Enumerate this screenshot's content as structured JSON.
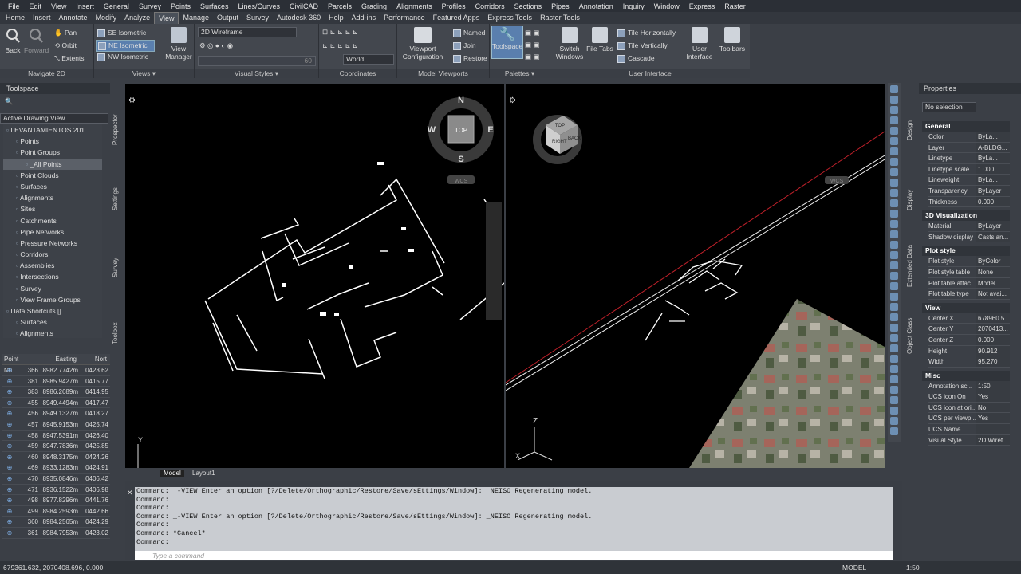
{
  "menu": [
    "File",
    "Edit",
    "View",
    "Insert",
    "General",
    "Survey",
    "Points",
    "Surfaces",
    "Lines/Curves",
    "CivilCAD",
    "Parcels",
    "Grading",
    "Alignments",
    "Profiles",
    "Corridors",
    "Sections",
    "Pipes",
    "Annotation",
    "Inquiry",
    "Window",
    "Express",
    "Raster"
  ],
  "tabs": [
    "Home",
    "Insert",
    "Annotate",
    "Modify",
    "Analyze",
    "View",
    "Manage",
    "Output",
    "Survey",
    "Autodesk 360",
    "Help",
    "Add-ins",
    "Performance",
    "Featured Apps",
    "Express Tools",
    "Raster Tools"
  ],
  "active_tab": "View",
  "ribbon": {
    "navigate": {
      "title": "Navigate 2D",
      "back": "Back",
      "forward": "Forward",
      "pan": "Pan",
      "orbit": "Orbit",
      "extents": "Extents"
    },
    "views": {
      "title": "Views",
      "items": [
        "SE Isometric",
        "NE Isometric",
        "NW Isometric"
      ],
      "view_manager": "View Manager"
    },
    "visual_styles": {
      "title": "Visual Styles",
      "current": "2D Wireframe",
      "opacity_value": "60"
    },
    "coordinates": {
      "title": "Coordinates",
      "world": "World"
    },
    "model_viewports": {
      "title": "Model Viewports",
      "viewport_config": "Viewport Configuration",
      "named": "Named",
      "join": "Join",
      "restore": "Restore"
    },
    "palettes": {
      "title": "Palettes",
      "toolspace": "Toolspace"
    },
    "user_interface": {
      "title": "User Interface",
      "switch_windows": "Switch Windows",
      "file_tabs": "File Tabs",
      "tile_h": "Tile Horizontally",
      "tile_v": "Tile Vertically",
      "cascade": "Cascade",
      "user_interface": "User Interface",
      "toolbars": "Toolbars"
    }
  },
  "toolspace": {
    "title": "Toolspace",
    "view_mode": "Active Drawing View",
    "tree": [
      "LEVANTAMIENTOS 201...",
      "Points",
      "Point Groups",
      "_All Points",
      "Point Clouds",
      "Surfaces",
      "Alignments",
      "Sites",
      "Catchments",
      "Pipe Networks",
      "Pressure Networks",
      "Corridors",
      "Assemblies",
      "Intersections",
      "Survey",
      "View Frame Groups",
      "Data Shortcuts []",
      "Surfaces",
      "Alignments"
    ],
    "side_tabs": [
      "Prospector",
      "Settings",
      "Survey",
      "Toolbox"
    ]
  },
  "points_table": {
    "headers": [
      "Point Nu...",
      "Easting",
      "Nort"
    ],
    "rows": [
      [
        "366",
        "8982.7742m",
        "0423.62"
      ],
      [
        "381",
        "8985.9427m",
        "0415.77"
      ],
      [
        "383",
        "8986.2689m",
        "0414.95"
      ],
      [
        "455",
        "8949.4494m",
        "0417.47"
      ],
      [
        "456",
        "8949.1327m",
        "0418.27"
      ],
      [
        "457",
        "8945.9153m",
        "0425.74"
      ],
      [
        "458",
        "8947.5391m",
        "0426.40"
      ],
      [
        "459",
        "8947.7836m",
        "0425.85"
      ],
      [
        "460",
        "8948.3175m",
        "0424.26"
      ],
      [
        "469",
        "8933.1283m",
        "0424.91"
      ],
      [
        "470",
        "8935.0846m",
        "0406.42"
      ],
      [
        "471",
        "8936.1522m",
        "0406.98"
      ],
      [
        "498",
        "8977.8296m",
        "0441.76"
      ],
      [
        "499",
        "8984.2593m",
        "0442.66"
      ],
      [
        "360",
        "8984.2565m",
        "0424.29"
      ],
      [
        "361",
        "8984.7953m",
        "0423.02"
      ]
    ]
  },
  "viewcube": {
    "north": "N",
    "south": "S",
    "east": "E",
    "west": "W",
    "top": "TOP",
    "wcs": "WCS"
  },
  "viewcube3d": {
    "face1": "RIGHT",
    "face2": "BACK",
    "face3": "TOP",
    "wcs": "WCS"
  },
  "axes": {
    "y": "Y",
    "z": "Z",
    "x": "X"
  },
  "layout_tabs": [
    "Model",
    "Layout1"
  ],
  "properties": {
    "title": "Properties",
    "selection": "No selection",
    "sections": [
      {
        "name": "General",
        "rows": [
          [
            "Color",
            "ByLa..."
          ],
          [
            "Layer",
            "A-BLDG..."
          ],
          [
            "Linetype",
            "ByLa..."
          ],
          [
            "Linetype scale",
            "1.000"
          ],
          [
            "Lineweight",
            "ByLa..."
          ],
          [
            "Transparency",
            "ByLayer"
          ],
          [
            "Thickness",
            "0.000"
          ]
        ]
      },
      {
        "name": "3D Visualization",
        "rows": [
          [
            "Material",
            "ByLayer"
          ],
          [
            "Shadow display",
            "Casts an..."
          ]
        ]
      },
      {
        "name": "Plot style",
        "rows": [
          [
            "Plot style",
            "ByColor"
          ],
          [
            "Plot style table",
            "None"
          ],
          [
            "Plot table attac...",
            "Model"
          ],
          [
            "Plot table type",
            "Not avai..."
          ]
        ]
      },
      {
        "name": "View",
        "rows": [
          [
            "Center X",
            "678960.5..."
          ],
          [
            "Center Y",
            "2070413..."
          ],
          [
            "Center Z",
            "0.000"
          ],
          [
            "Height",
            "90.912"
          ],
          [
            "Width",
            "95.270"
          ]
        ]
      },
      {
        "name": "Misc",
        "rows": [
          [
            "Annotation sc...",
            "1:50"
          ],
          [
            "UCS icon On",
            "Yes"
          ],
          [
            "UCS icon at ori...",
            "No"
          ],
          [
            "UCS per viewp...",
            "Yes"
          ],
          [
            "UCS Name",
            ""
          ],
          [
            "Visual Style",
            "2D Wiref..."
          ]
        ]
      }
    ],
    "side_tabs": [
      "Design",
      "Display",
      "Extended Data",
      "Object Class"
    ]
  },
  "command": {
    "lines": [
      "Command: _-VIEW Enter an option [?/Delete/Orthographic/Restore/Save/sEttings/Window]: _NEISO Regenerating model.",
      "Command:",
      "Command:",
      "Command: _-VIEW Enter an option [?/Delete/Orthographic/Restore/Save/sEttings/Window]: _NEISO Regenerating model.",
      "Command:",
      "Command: *Cancel*",
      "Command:"
    ],
    "placeholder": "Type a command"
  },
  "status": {
    "coords": "679361.632, 2070408.696, 0.000",
    "model": "MODEL",
    "scale": "1:50"
  }
}
